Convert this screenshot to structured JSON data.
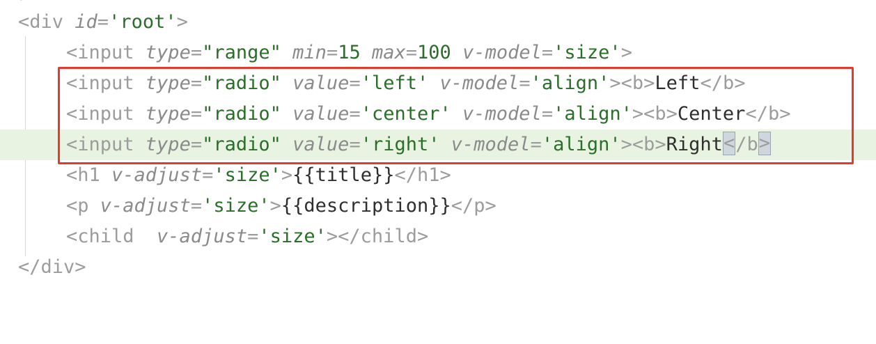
{
  "editor": {
    "top_fragment": "}",
    "lines": [
      {
        "tag_open": "<div ",
        "attr1": "id",
        "eq1": "=",
        "val1": "'root'",
        "close": ">"
      },
      {
        "tag_open": "<input ",
        "attr1": "type",
        "eq1": "=",
        "val1": "\"range\"",
        "attr2": "min",
        "eq2": "=",
        "val2": "15",
        "attr3": "max",
        "eq3": "=",
        "val3": "100",
        "attr4": "v-model",
        "eq4": "=",
        "val4": "'size'",
        "close": ">"
      },
      {
        "tag_open": "<input ",
        "attr1": "type",
        "eq1": "=",
        "val1": "\"radio\"",
        "attr2": "value",
        "eq2": "=",
        "val2": "'left'",
        "attr3": "v-model",
        "eq3": "=",
        "val3": "'align'",
        "close": "><b>",
        "text": "Left",
        "end": "</b>"
      },
      {
        "tag_open": "<input ",
        "attr1": "type",
        "eq1": "=",
        "val1": "\"radio\"",
        "attr2": "value",
        "eq2": "=",
        "val2": "'center'",
        "attr3": "v-model",
        "eq3": "=",
        "val3": "'align'",
        "close": "><b>",
        "text": "Center",
        "end": "</b>"
      },
      {
        "tag_open": "<input ",
        "attr1": "type",
        "eq1": "=",
        "val1": "\"radio\"",
        "attr2": "value",
        "eq2": "=",
        "val2": "'right'",
        "attr3": "v-model",
        "eq3": "=",
        "val3": "'align'",
        "close": "><b>",
        "text": "Right",
        "end_a": "<",
        "end_b": "/b",
        "end_c": ">"
      },
      {
        "tag_open": "<h1 ",
        "attr1": "v-adjust",
        "eq1": "=",
        "val1": "'size'",
        "close": ">",
        "text": "{{title}}",
        "end": "</h1>"
      },
      {
        "tag_open": "<p ",
        "attr1": "v-adjust",
        "eq1": "=",
        "val1": "'size'",
        "close": ">",
        "text": "{{description}}",
        "end": "</p>"
      },
      {
        "tag_open": "<child  ",
        "attr1": "v-adjust",
        "eq1": "=",
        "val1": "'size'",
        "close": "></child>"
      },
      {
        "tag_open": "</div>"
      }
    ]
  },
  "colors": {
    "highlight_border": "#e23b2e",
    "active_line": "#e9f3e2",
    "string": "#2a6e2a"
  }
}
